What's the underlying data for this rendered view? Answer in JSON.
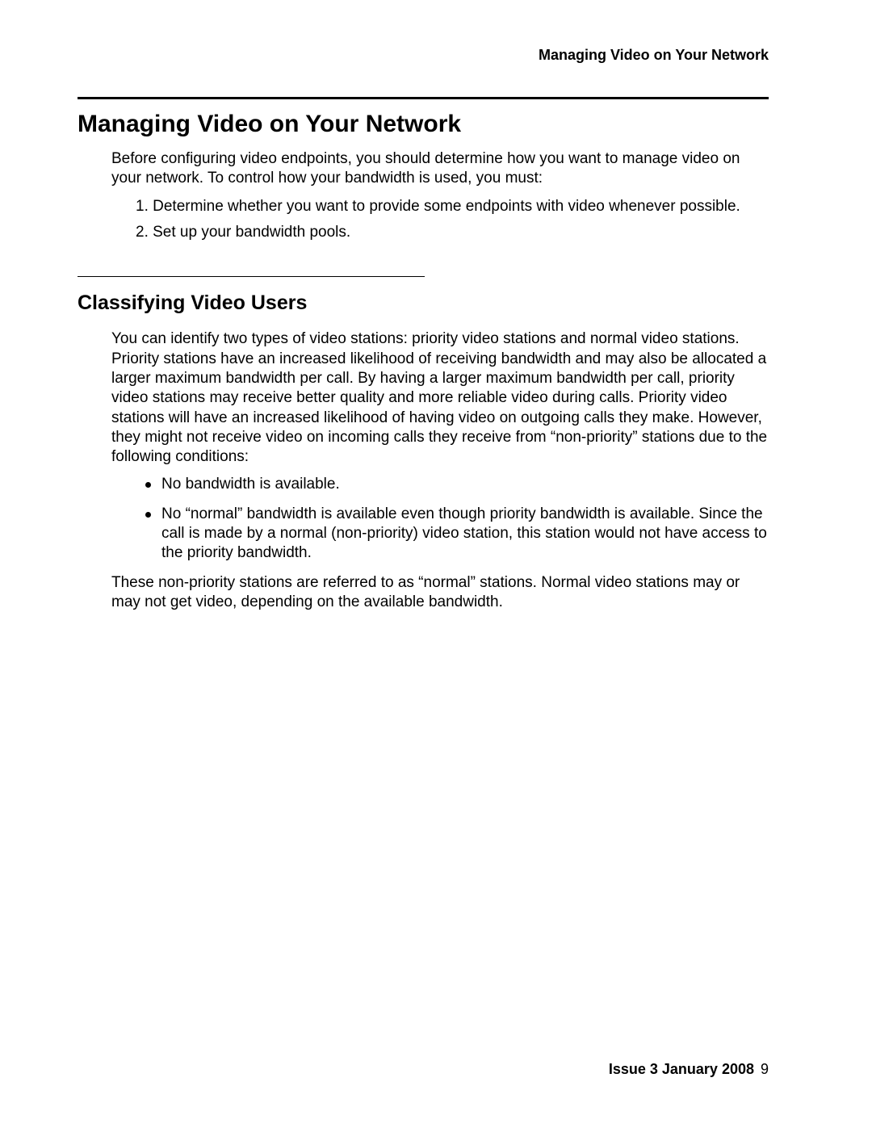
{
  "header": {
    "running_title": "Managing Video on Your Network"
  },
  "main": {
    "heading": "Managing Video on Your Network",
    "intro": "Before configuring video endpoints, you should determine how you want to manage video on your network. To control how your bandwidth is used, you must:",
    "steps": [
      "1. Determine whether you want to provide some endpoints with video whenever possible.",
      "2. Set up your bandwidth pools."
    ],
    "subheading": "Classifying Video Users",
    "sub_intro": "You can identify two types of video stations: priority video stations and normal video stations. Priority stations have an increased likelihood of receiving bandwidth and may also be allocated a larger maximum bandwidth per call. By having a larger maximum bandwidth per call, priority video stations may receive better quality and more reliable video during calls. Priority video stations will have an increased likelihood of having video on outgoing calls they make. However, they might not receive video on incoming calls they receive from “non-priority” stations due to the following conditions:",
    "bullets": [
      "No bandwidth is available.",
      "No “normal” bandwidth is available even though priority bandwidth is available. Since the call is made by a normal (non-priority) video station, this station would not have access to the priority bandwidth."
    ],
    "closing": "These non-priority stations are referred to as “normal” stations. Normal video stations may or may not get video, depending on the available bandwidth."
  },
  "footer": {
    "issue": "Issue 3   January 2008",
    "page": "9"
  }
}
